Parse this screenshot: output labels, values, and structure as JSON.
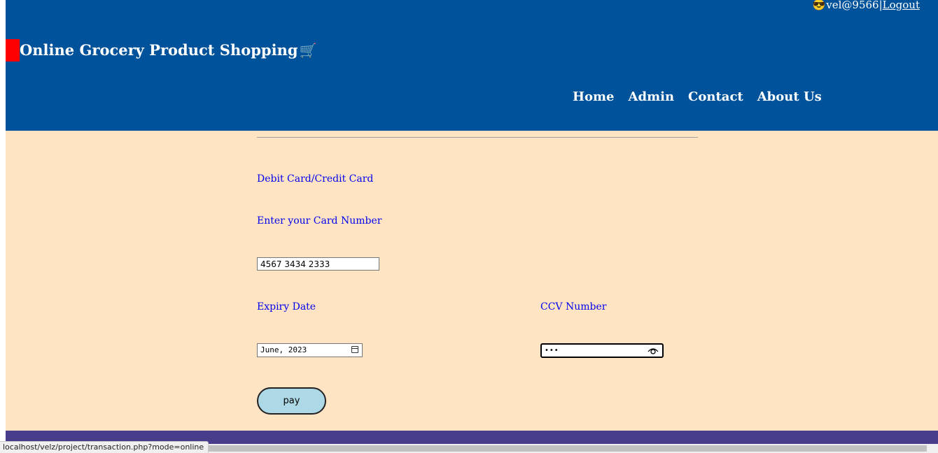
{
  "header": {
    "user": {
      "emoji": "😎",
      "username": "vel@9566",
      "separator": "|",
      "logout_label": "Logout"
    },
    "brand_title": "Online Grocery Product Shopping",
    "brand_cart_emoji": "🛒",
    "nav": [
      {
        "label": "Home"
      },
      {
        "label": "Admin"
      },
      {
        "label": "Contact"
      },
      {
        "label": "About Us"
      }
    ]
  },
  "form": {
    "payment_method_label": "Debit Card/Credit Card",
    "card_number_label": "Enter your Card Number",
    "card_number_value": "4567 3434 2333",
    "expiry_label": "Expiry Date",
    "expiry_value": "June, 2023",
    "ccv_label": "CCV Number",
    "ccv_masked": "•••",
    "pay_button_label": "pay"
  },
  "status_bar": {
    "url": "localhost/velz/project/transaction.php?mode=online"
  },
  "colors": {
    "header_bg": "#00529b",
    "page_bg": "#ffe4c4",
    "label_color": "#0000ee",
    "pay_button_bg": "#add8e6",
    "footer_bg": "#483d8b",
    "brand_marker": "#ff0000"
  },
  "icons": {
    "calendar": "calendar-icon",
    "eye": "eye-icon",
    "cart": "cart-icon"
  }
}
